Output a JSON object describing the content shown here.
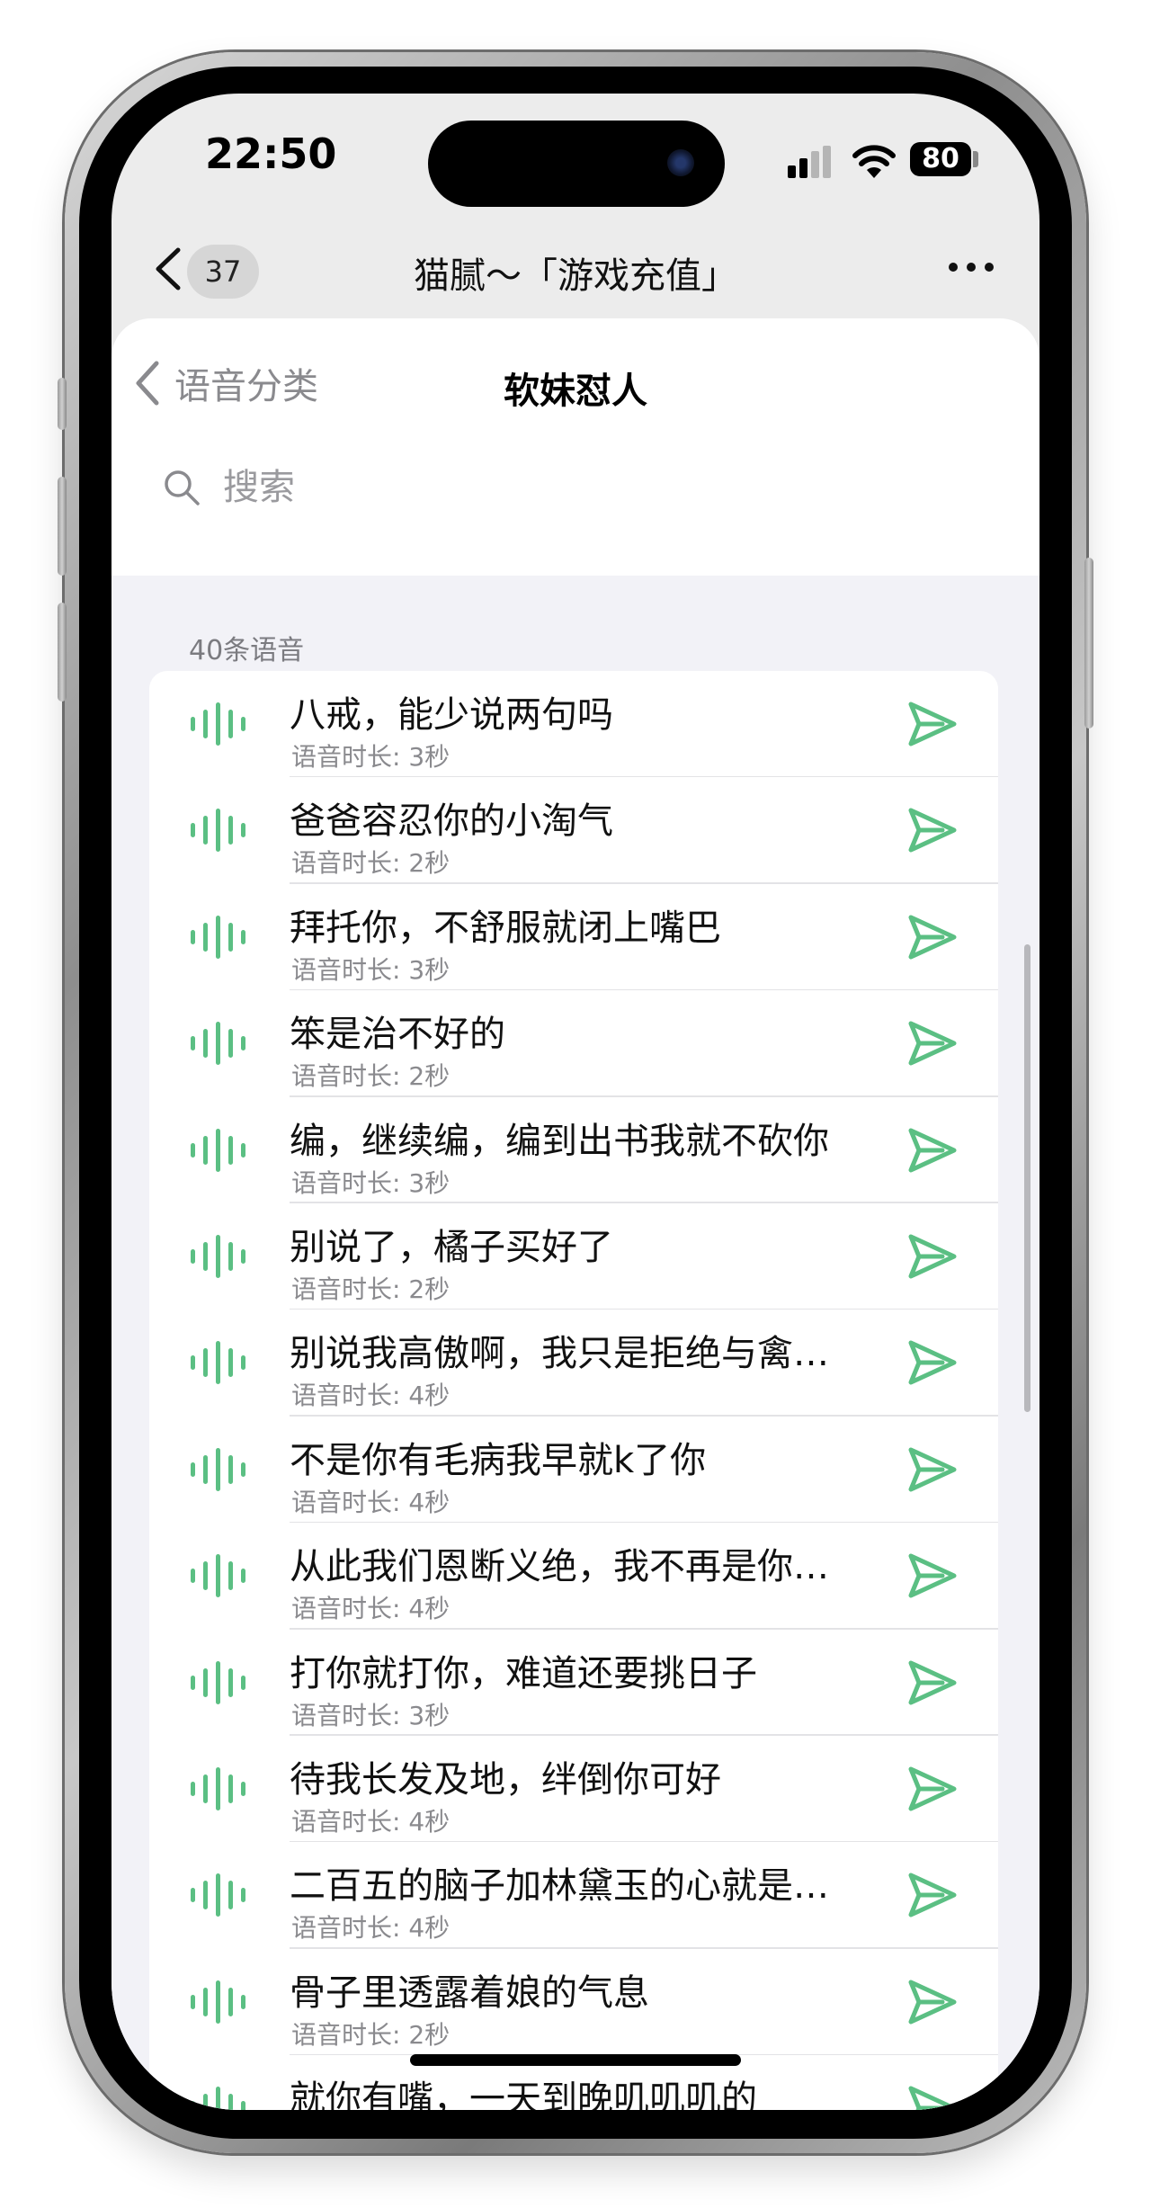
{
  "status_bar": {
    "time": "22:50",
    "battery": "80"
  },
  "nav": {
    "badge": "37",
    "title": "猫腻～「游戏充值」"
  },
  "sheet": {
    "back_label": "语音分类",
    "title": "软妹怼人"
  },
  "search": {
    "placeholder": "搜索"
  },
  "list": {
    "count_label": "40条语音",
    "items": [
      {
        "title": "八戒，能少说两句吗",
        "duration": "语音时长: 3秒"
      },
      {
        "title": "爸爸容忍你的小淘气",
        "duration": "语音时长: 2秒"
      },
      {
        "title": "拜托你，不舒服就闭上嘴巴",
        "duration": "语音时长: 3秒"
      },
      {
        "title": "笨是治不好的",
        "duration": "语音时长: 2秒"
      },
      {
        "title": "编，继续编，编到出书我就不砍你",
        "duration": "语音时长: 3秒"
      },
      {
        "title": "别说了，橘子买好了",
        "duration": "语音时长: 2秒"
      },
      {
        "title": "别说我高傲啊，我只是拒绝与禽…",
        "duration": "语音时长: 4秒"
      },
      {
        "title": "不是你有毛病我早就k了你",
        "duration": "语音时长: 4秒"
      },
      {
        "title": "从此我们恩断义绝，我不再是你…",
        "duration": "语音时长: 4秒"
      },
      {
        "title": "打你就打你，难道还要挑日子",
        "duration": "语音时长: 3秒"
      },
      {
        "title": "待我长发及地，绊倒你可好",
        "duration": "语音时长: 4秒"
      },
      {
        "title": "二百五的脑子加林黛玉的心就是…",
        "duration": "语音时长: 4秒"
      },
      {
        "title": "骨子里透露着娘的气息",
        "duration": "语音时长: 2秒"
      },
      {
        "title": "就你有嘴，一天到晚叽叽叽的",
        "duration": ""
      }
    ]
  },
  "colors": {
    "accent_green": "#5bbf83"
  }
}
